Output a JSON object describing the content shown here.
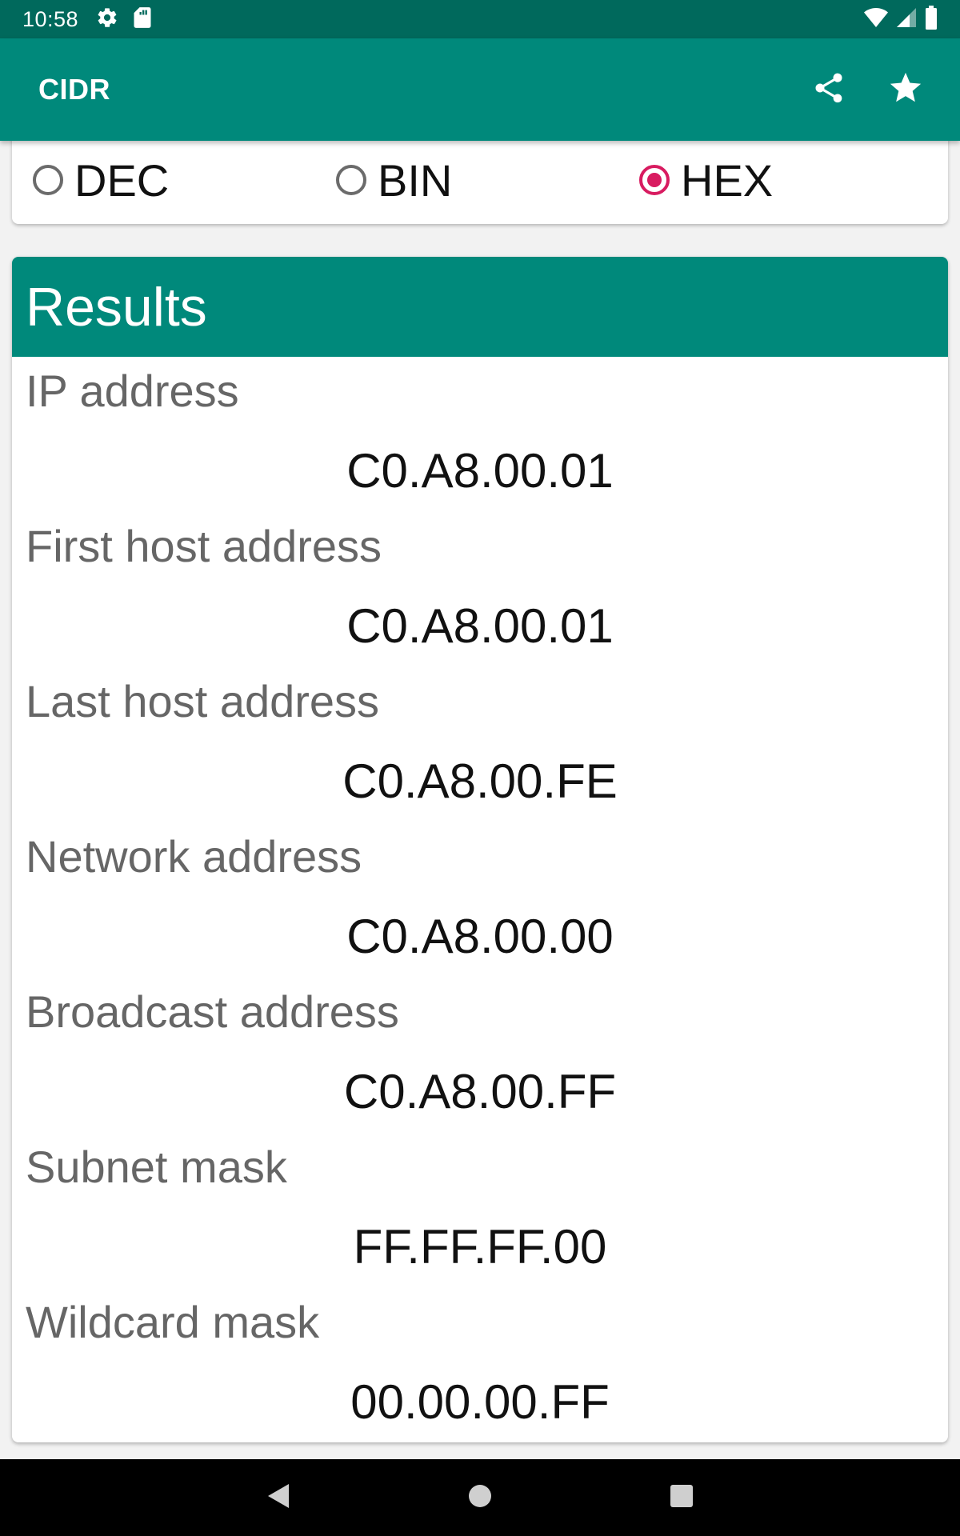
{
  "status_bar": {
    "time": "10:58",
    "left_icons": [
      "gear-icon",
      "sd-card-icon"
    ],
    "right_icons": [
      "wifi-icon",
      "signal-icon",
      "battery-icon"
    ]
  },
  "app_bar": {
    "title": "CIDR",
    "actions": [
      "share-icon",
      "star-icon"
    ],
    "color": "#00897b"
  },
  "format_selector": {
    "options": [
      {
        "label": "DEC",
        "checked": false
      },
      {
        "label": "BIN",
        "checked": false
      },
      {
        "label": "HEX",
        "checked": true
      }
    ],
    "accent": "#d81b60"
  },
  "results": {
    "title": "Results",
    "items": [
      {
        "label": "IP address",
        "value": "C0.A8.00.01"
      },
      {
        "label": "First host address",
        "value": "C0.A8.00.01"
      },
      {
        "label": "Last host address",
        "value": "C0.A8.00.FE"
      },
      {
        "label": "Network address",
        "value": "C0.A8.00.00"
      },
      {
        "label": "Broadcast address",
        "value": "C0.A8.00.FF"
      },
      {
        "label": "Subnet mask",
        "value": "FF.FF.FF.00"
      },
      {
        "label": "Wildcard mask",
        "value": "00.00.00.FF"
      }
    ]
  },
  "nav_bar": {
    "buttons": [
      "back-icon",
      "home-icon",
      "recents-icon"
    ]
  }
}
